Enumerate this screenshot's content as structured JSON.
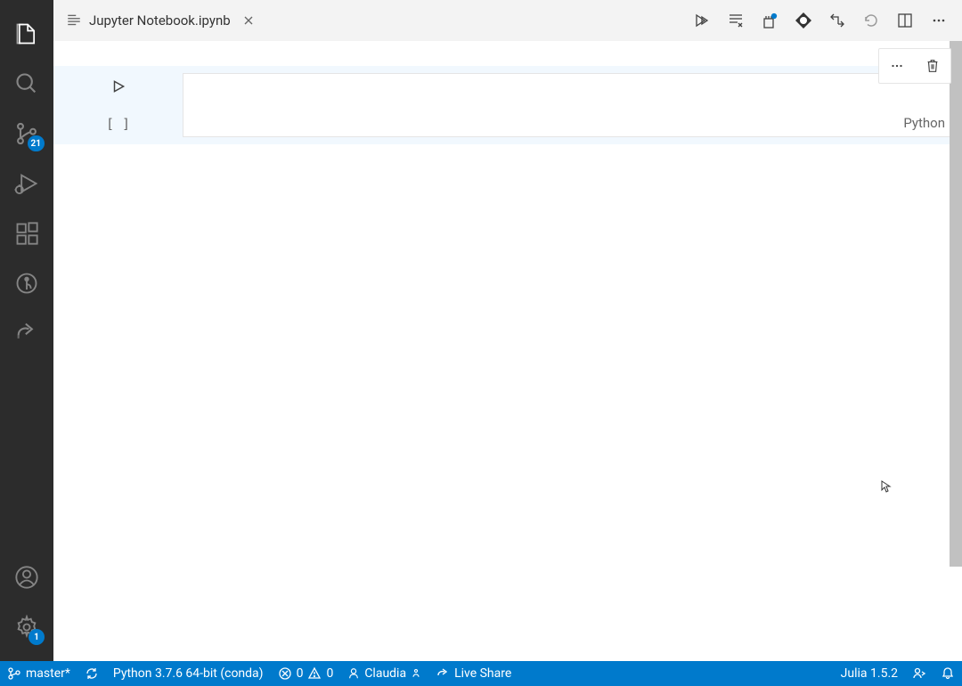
{
  "tab": {
    "filename": "Jupyter Notebook.ipynb"
  },
  "activitybar": {
    "source_control_badge": "21",
    "settings_badge": "1"
  },
  "cell": {
    "execution_label": "[  ]",
    "language": "Python"
  },
  "statusbar": {
    "branch": "master*",
    "python_env": "Python 3.7.6 64-bit (conda)",
    "errors": "0",
    "warnings": "0",
    "user": "Claudia",
    "liveshare": "Live Share",
    "julia": "Julia 1.5.2"
  }
}
